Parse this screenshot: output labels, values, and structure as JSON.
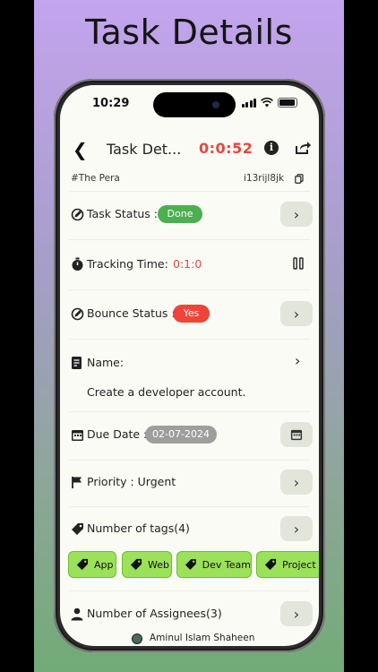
{
  "hero_title": "Task Details",
  "status_bar": {
    "time": "10:29"
  },
  "nav": {
    "back_icon": "chevron-left-icon",
    "title": "Task Det...",
    "timer": "0:0:52",
    "info_icon": "info-icon",
    "share_icon": "share-icon"
  },
  "meta": {
    "project": "#The Pera",
    "task_id": "i13rijl8jk",
    "copy_icon": "copy-icon"
  },
  "task_status": {
    "label": "Task Status :",
    "value": "Done",
    "color": "#4caf50"
  },
  "tracking": {
    "label": "Tracking Time:",
    "value": "0:1:0",
    "value_color": "#e5473e"
  },
  "bounce_status": {
    "label": "Bounce Status :",
    "value": "Yes",
    "color": "#f04438"
  },
  "name": {
    "label": "Name:",
    "value": "Create a developer account."
  },
  "due_date": {
    "label": "Due Date :",
    "value": "02-07-2024"
  },
  "priority": {
    "label": "Priority : Urgent"
  },
  "tags": {
    "label": "Number of tags(4)",
    "items": [
      "App",
      "Web",
      "Dev Team",
      "Project"
    ],
    "color": "#9be15a"
  },
  "assignees": {
    "label": "Number of Assignees(3)",
    "first": "Aminul Islam Shaheen"
  }
}
